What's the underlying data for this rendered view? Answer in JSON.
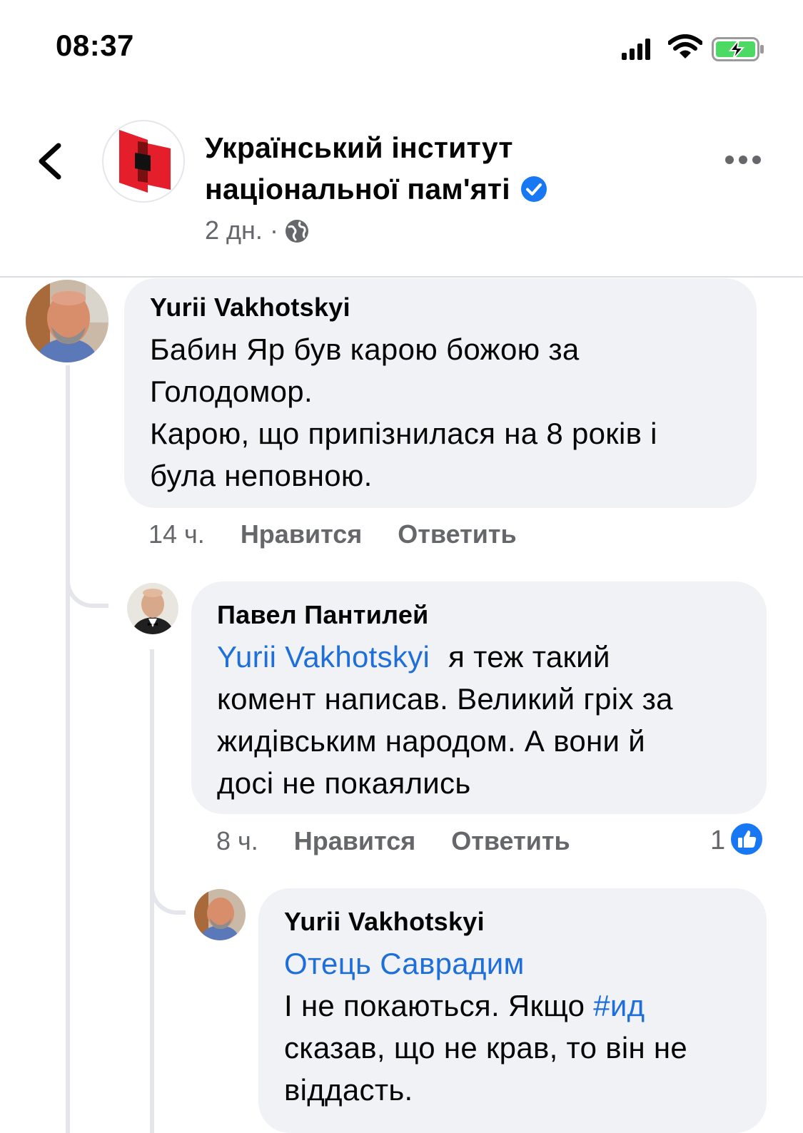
{
  "status_bar": {
    "time": "08:37"
  },
  "header": {
    "page_name": "Український інститут національної пам'яті",
    "post_age": "2 дн.",
    "separator": "·"
  },
  "comments": [
    {
      "author": "Yurii Vakhotskyi",
      "text": "Бабин Яр був карою божою за Голодомор.\nКарою, що припізнилася на 8 років і була неповною.",
      "line1": "Бабин Яр був карою божою за",
      "line2": "Голодомор.",
      "line3": "Карою, що припізнилася на 8 років і",
      "line4": "була неповною.",
      "time": "14 ч.",
      "like_label": "Нравится",
      "reply_label": "Ответить"
    },
    {
      "author": "Павел Пантилей",
      "mention": "Yurii Vakhotskyi",
      "line1_rest": "я теж такий",
      "line2": "комент написав. Великий гріх за",
      "line3": "жидівським народом. А вони й",
      "line4": "досі не покаялись",
      "time": "8 ч.",
      "like_label": "Нравится",
      "reply_label": "Ответить",
      "reaction_count": "1"
    },
    {
      "author": "Yurii Vakhotskyi",
      "mention": "Отець Саврадим",
      "line2_start": "І не покаються. Якщо",
      "hashtag": "#ид",
      "line3": "сказав, що не крав, то він не",
      "line4": "віддасть."
    }
  ],
  "colors": {
    "link_blue": "#1e6fd9",
    "bubble_bg": "#f0f2f5",
    "meta_gray": "#65676b",
    "logo_red": "#e41e2b",
    "battery_green": "#4cd964",
    "verified_blue": "#1877f2"
  },
  "icons": [
    "signal-icon",
    "wifi-icon",
    "battery-charging-icon",
    "back-chevron-icon",
    "verified-badge-icon",
    "globe-icon",
    "more-options-icon",
    "like-reaction-icon"
  ]
}
